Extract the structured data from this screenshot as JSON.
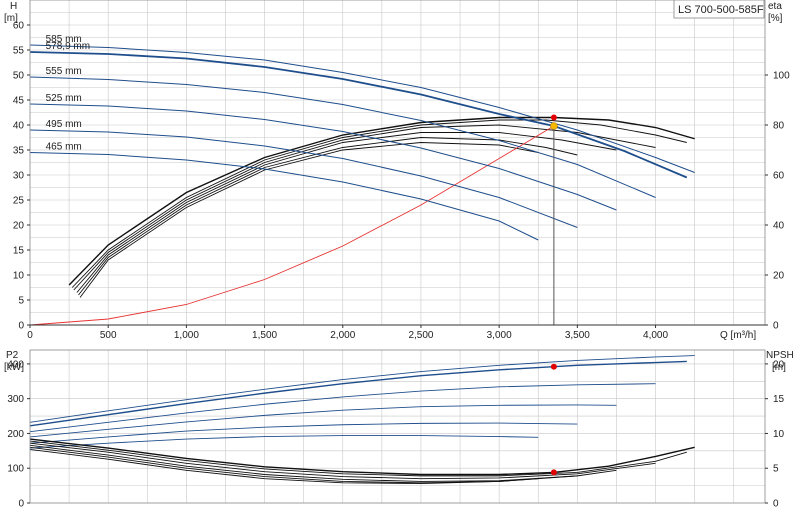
{
  "model_label": "LS 700-500-585F",
  "colors": {
    "head_curve": "#1f4e8c",
    "efficiency_curve": "#111111",
    "system_curve": "#e83232",
    "npsh_curve": "#111111",
    "power_curve": "#1f4e8c",
    "duty_point_top": "#f5b800",
    "duty_point": "#e00000",
    "grid": "#c8c8c8",
    "duty_line": "#555555"
  },
  "chart_data": [
    {
      "id": "head",
      "type": "line",
      "x_label": "Q [m³/h]",
      "left_axis": {
        "label_top": "H",
        "label_unit": "[m]",
        "ylim": [
          0,
          65
        ],
        "ticks": [
          "0",
          "5",
          "10",
          "15",
          "20",
          "25",
          "30",
          "35",
          "40",
          "45",
          "50",
          "55",
          "60"
        ]
      },
      "right_axis": {
        "label_top": "eta",
        "label_unit": "[%]",
        "ylim": [
          0,
          130
        ],
        "ticks": [
          "0",
          "20",
          "40",
          "60",
          "80",
          "100"
        ]
      },
      "x_ticks": [
        "0",
        "500",
        "1,000",
        "1,500",
        "2,000",
        "2,500",
        "3,000",
        "3,500",
        "4,000"
      ],
      "xlim": [
        0,
        4700
      ],
      "head_curves": [
        {
          "name": "585 mm",
          "x": [
            0,
            500,
            1000,
            1500,
            2000,
            2500,
            3000,
            3500,
            4000,
            4250
          ],
          "y": [
            56,
            55.5,
            54.5,
            53,
            50.5,
            47.5,
            43.5,
            39,
            33.5,
            30.5
          ]
        },
        {
          "name": "578,9 mm",
          "x": [
            0,
            500,
            1000,
            1500,
            2000,
            2500,
            3000,
            3350,
            3800,
            4200
          ],
          "y": [
            54.6,
            54.2,
            53.3,
            51.6,
            49.2,
            46.1,
            42.2,
            39.8,
            34.8,
            29.5
          ]
        },
        {
          "name": "555 mm",
          "x": [
            0,
            500,
            1000,
            1500,
            2000,
            2500,
            3000,
            3500,
            4000
          ],
          "y": [
            49.6,
            49.1,
            48.1,
            46.5,
            44.1,
            40.9,
            36.9,
            32.1,
            25.5
          ]
        },
        {
          "name": "525 mm",
          "x": [
            0,
            500,
            1000,
            1500,
            2000,
            2500,
            3000,
            3500,
            3750
          ],
          "y": [
            44.2,
            43.8,
            42.8,
            41.1,
            38.7,
            35.4,
            31.3,
            26.1,
            23
          ]
        },
        {
          "name": "495 mm",
          "x": [
            0,
            500,
            1000,
            1500,
            2000,
            2500,
            3000,
            3500
          ],
          "y": [
            39,
            38.6,
            37.6,
            35.8,
            33.3,
            29.8,
            25.5,
            19.5
          ]
        },
        {
          "name": "465 mm",
          "x": [
            0,
            500,
            1000,
            1500,
            2000,
            2500,
            3000,
            3250
          ],
          "y": [
            34.5,
            34.1,
            33,
            31.2,
            28.6,
            25.2,
            20.8,
            17
          ]
        }
      ],
      "efficiency_curves": [
        {
          "x": [
            250,
            500,
            1000,
            1500,
            2000,
            2500,
            3000,
            3350,
            3700,
            4000,
            4250
          ],
          "y": [
            16,
            32,
            53,
            67,
            76,
            81,
            83,
            83,
            82,
            79,
            74.5
          ]
        },
        {
          "x": [
            270,
            500,
            1000,
            1500,
            2000,
            2500,
            3000,
            3300,
            3650,
            4000,
            4200
          ],
          "y": [
            15,
            30,
            51,
            66,
            75,
            80,
            82,
            82,
            80,
            76,
            73
          ]
        },
        {
          "x": [
            280,
            500,
            1000,
            1500,
            2000,
            2500,
            3000,
            3500,
            4000
          ],
          "y": [
            14,
            29,
            50,
            65,
            74,
            79,
            80,
            77,
            71
          ]
        },
        {
          "x": [
            300,
            500,
            1000,
            1500,
            2000,
            2500,
            3000,
            3400,
            3750
          ],
          "y": [
            13,
            28,
            49,
            64,
            73,
            77,
            77,
            74,
            70
          ]
        },
        {
          "x": [
            310,
            500,
            1000,
            1500,
            2000,
            2500,
            3000,
            3300,
            3500
          ],
          "y": [
            12,
            27,
            48,
            63,
            71,
            75,
            74,
            71,
            68
          ]
        },
        {
          "x": [
            320,
            500,
            1000,
            1500,
            2000,
            2500,
            3000,
            3250
          ],
          "y": [
            11,
            26,
            47,
            62,
            70,
            73,
            72,
            69
          ]
        }
      ],
      "system_curve": {
        "x": [
          0,
          500,
          1000,
          1500,
          2000,
          2500,
          3000,
          3350
        ],
        "y": [
          0,
          1.2,
          4.1,
          9.1,
          15.8,
          24,
          33.3,
          39.8
        ]
      },
      "duty_point": {
        "x": 3350,
        "y": 39.8,
        "eta": 83
      }
    },
    {
      "id": "power_npsh",
      "type": "line",
      "left_axis": {
        "label_top": "P2",
        "label_unit": "[kW]",
        "ylim": [
          0,
          440
        ],
        "ticks": [
          "0",
          "100",
          "200",
          "300",
          "400"
        ]
      },
      "right_axis": {
        "label_top": "NPSH",
        "label_unit": "[m]",
        "ylim": [
          0,
          22
        ],
        "ticks": [
          "0",
          "5",
          "10",
          "15",
          "20"
        ]
      },
      "xlim": [
        0,
        4700
      ],
      "power_curves": [
        {
          "x": [
            0,
            500,
            1000,
            1500,
            2000,
            2500,
            3000,
            3500,
            4000,
            4250
          ],
          "y": [
            232,
            265,
            297,
            327,
            355,
            378,
            396,
            410,
            420,
            424
          ]
        },
        {
          "x": [
            0,
            500,
            1000,
            1500,
            2000,
            2500,
            3000,
            3500,
            4000,
            4200
          ],
          "y": [
            222,
            254,
            286,
            316,
            343,
            366,
            383,
            396,
            404,
            407
          ]
        },
        {
          "x": [
            0,
            500,
            1000,
            1500,
            2000,
            2500,
            3000,
            3500,
            4000
          ],
          "y": [
            205,
            232,
            259,
            284,
            305,
            322,
            334,
            340,
            343
          ]
        },
        {
          "x": [
            0,
            500,
            1000,
            1500,
            2000,
            2500,
            3000,
            3500,
            3750
          ],
          "y": [
            190,
            212,
            233,
            252,
            267,
            277,
            281,
            282,
            281
          ]
        },
        {
          "x": [
            0,
            500,
            1000,
            1500,
            2000,
            2500,
            3000,
            3500
          ],
          "y": [
            172,
            190,
            207,
            218,
            225,
            229,
            230,
            227
          ]
        },
        {
          "x": [
            0,
            500,
            1000,
            1500,
            2000,
            2500,
            3000,
            3250
          ],
          "y": [
            158,
            172,
            184,
            191,
            194,
            194,
            191,
            189
          ]
        }
      ],
      "npsh_curves": [
        {
          "x": [
            0,
            500,
            1000,
            1500,
            2000,
            2500,
            3000,
            3350,
            3700,
            4000,
            4250
          ],
          "y": [
            9.2,
            7.9,
            6.4,
            5.2,
            4.5,
            4.1,
            4.1,
            4.4,
            5.3,
            6.7,
            8.0
          ]
        },
        {
          "x": [
            0,
            500,
            1000,
            1500,
            2000,
            2500,
            3000,
            3500,
            4000,
            4200
          ],
          "y": [
            8.9,
            7.6,
            6.1,
            4.9,
            4.2,
            3.9,
            3.9,
            4.4,
            6.0,
            7.3
          ]
        },
        {
          "x": [
            0,
            500,
            1000,
            1500,
            2000,
            2500,
            3000,
            3500,
            4000
          ],
          "y": [
            8.6,
            7.3,
            5.7,
            4.5,
            3.8,
            3.5,
            3.6,
            4.2,
            5.7
          ]
        },
        {
          "x": [
            0,
            500,
            1000,
            1500,
            2000,
            2500,
            3000,
            3500,
            3750
          ],
          "y": [
            8.3,
            6.9,
            5.3,
            4.1,
            3.4,
            3.1,
            3.2,
            3.9,
            4.7
          ]
        },
        {
          "x": [
            0,
            500,
            1000,
            1500,
            2000,
            2500,
            3000,
            3500
          ],
          "y": [
            8.0,
            6.6,
            5.0,
            3.8,
            3.1,
            2.9,
            3.1,
            3.9
          ]
        },
        {
          "x": [
            0,
            500,
            1000,
            1500,
            2000,
            2500,
            3000,
            3250
          ],
          "y": [
            7.7,
            6.3,
            4.7,
            3.5,
            2.9,
            2.8,
            3.1,
            3.5
          ]
        }
      ],
      "duty_power": {
        "x": 3350,
        "y": 392
      },
      "duty_npsh": {
        "x": 3350,
        "y": 4.4
      }
    }
  ]
}
